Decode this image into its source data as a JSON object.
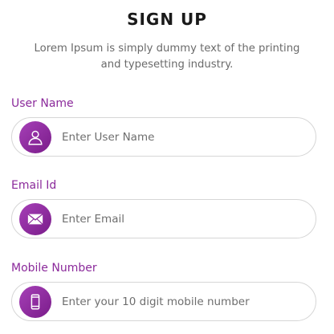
{
  "header": {
    "title": "SIGN UP",
    "subtitle": "Lorem Ipsum is simply dummy text of the printing and typesetting industry."
  },
  "fields": [
    {
      "label": "User Name",
      "placeholder": "Enter User Name",
      "icon": "user-icon"
    },
    {
      "label": "Email Id",
      "placeholder": "Enter Email",
      "icon": "envelope-icon"
    },
    {
      "label": "Mobile Number",
      "placeholder": "Enter your 10 digit mobile number",
      "icon": "mobile-phone-icon"
    }
  ],
  "colors": {
    "accent": "#8b2a9b",
    "icon_gradient_start": "#a640b7",
    "icon_gradient_end": "#7a1c8a",
    "field_border": "#d6d6d6"
  }
}
